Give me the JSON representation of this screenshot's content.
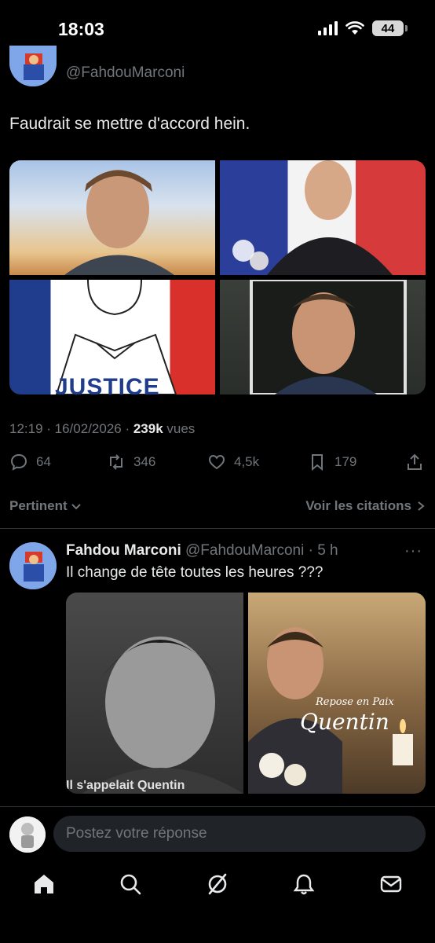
{
  "status_bar": {
    "time": "18:03",
    "battery": "44"
  },
  "main_tweet": {
    "handle": "@FahdouMarconi",
    "text": "Faudrait se mettre d'accord hein.",
    "image_caption": "JUSTICE",
    "timestamp": "12:19 · 16/02/2026 · ",
    "views_count": "239k",
    "views_label": " vues",
    "actions": {
      "replies": "64",
      "reposts": "346",
      "likes": "4,5k",
      "bookmarks": "179"
    }
  },
  "sort": {
    "label": "Pertinent",
    "quotes_link": "Voir les citations"
  },
  "reply_tweet": {
    "name": "Fahdou Marconi",
    "handle_time": "@FahdouMarconi · 5 h",
    "more": "···",
    "text": "Il change de tête toutes les heures ???",
    "image1_caption": "Il s'appelait Quentin",
    "image2_line1": "Repose en Paix",
    "image2_line2": "Quentin"
  },
  "reply_bar": {
    "placeholder": "Postez votre réponse"
  },
  "nav": {
    "items": [
      "home-icon",
      "search-icon",
      "grok-icon",
      "notifications-icon",
      "messages-icon"
    ]
  },
  "colors": {
    "background": "#000000",
    "text": "#e7e9ea",
    "muted": "#71767b",
    "input_bg": "#202327"
  }
}
